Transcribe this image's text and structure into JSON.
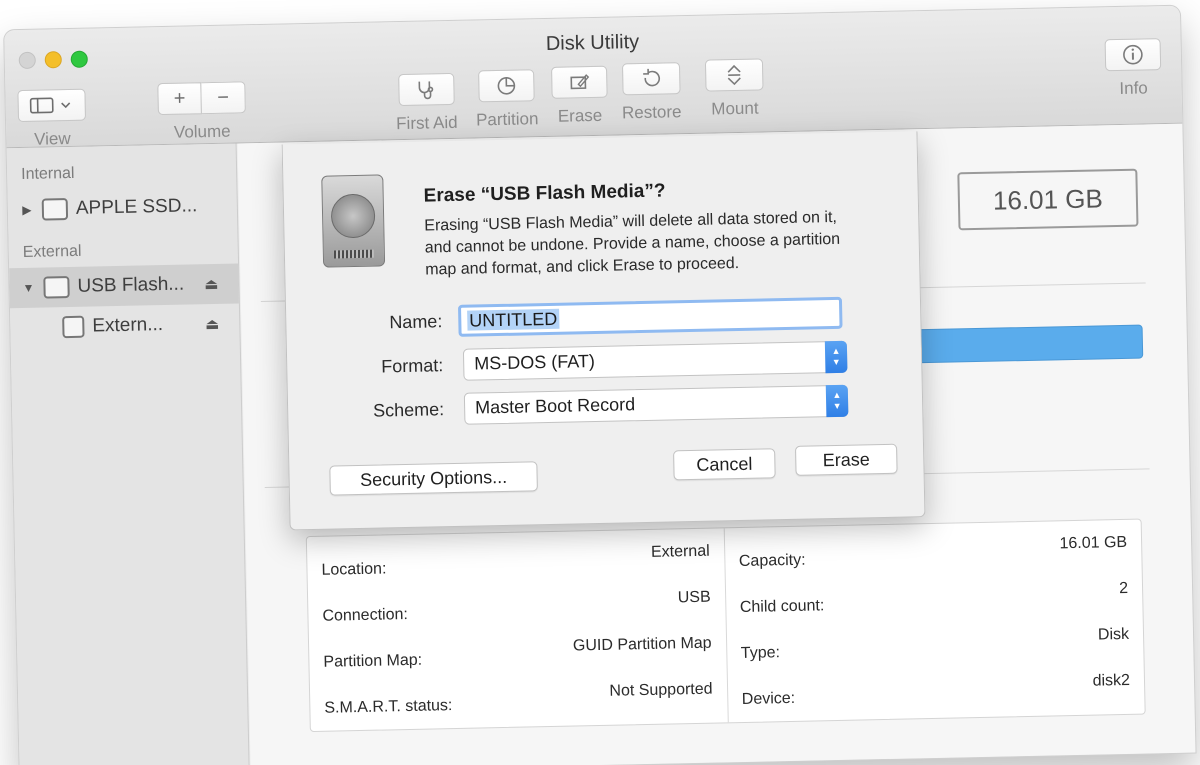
{
  "window": {
    "title": "Disk Utility"
  },
  "toolbar": {
    "view_label": "View",
    "view_icon": "sidebar-icon",
    "volume_label": "Volume",
    "volume_add": "+",
    "volume_remove": "−",
    "first_aid": "First Aid",
    "first_aid_icon": "stethoscope-icon",
    "partition": "Partition",
    "partition_icon": "pie-icon",
    "erase": "Erase",
    "erase_icon": "erase-icon",
    "restore": "Restore",
    "restore_icon": "restore-icon",
    "mount": "Mount",
    "mount_icon": "mount-icon",
    "info": "Info",
    "info_icon": "info-icon"
  },
  "sidebar": {
    "internal_header": "Internal",
    "internal_items": [
      {
        "label": "APPLE SSD..."
      }
    ],
    "external_header": "External",
    "external_items": [
      {
        "label": "USB Flash...",
        "selected": true
      },
      {
        "label": "Extern..."
      }
    ]
  },
  "main": {
    "capacity_display": "16.01 GB",
    "usage_bar_color": "#5aacec",
    "info_left": [
      {
        "label": "Location:",
        "value": "External"
      },
      {
        "label": "Connection:",
        "value": "USB"
      },
      {
        "label": "Partition Map:",
        "value": "GUID Partition Map"
      },
      {
        "label": "S.M.A.R.T. status:",
        "value": "Not Supported"
      }
    ],
    "info_right": [
      {
        "label": "Capacity:",
        "value": "16.01 GB"
      },
      {
        "label": "Child count:",
        "value": "2"
      },
      {
        "label": "Type:",
        "value": "Disk"
      },
      {
        "label": "Device:",
        "value": "disk2"
      }
    ]
  },
  "dialog": {
    "title": "Erase “USB Flash Media”?",
    "description": "Erasing “USB Flash Media” will delete all data stored on it, and cannot be undone. Provide a name, choose a partition map and format, and click Erase to proceed.",
    "name_label": "Name:",
    "name_value": "UNTITLED",
    "format_label": "Format:",
    "format_value": "MS-DOS (FAT)",
    "scheme_label": "Scheme:",
    "scheme_value": "Master Boot Record",
    "security_button": "Security Options...",
    "cancel_button": "Cancel",
    "erase_button": "Erase"
  }
}
